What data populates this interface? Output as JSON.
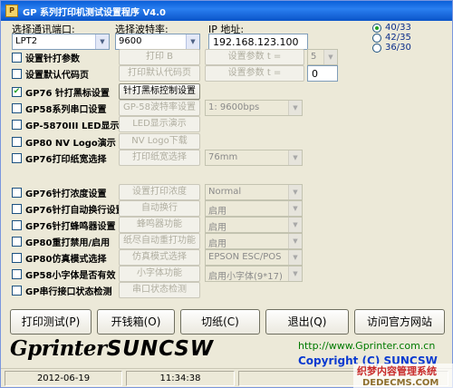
{
  "window": {
    "title": "GP 系列打印机测试设置程序 V4.0"
  },
  "port": {
    "label": "选择通讯端口:",
    "value": "LPT2"
  },
  "baud": {
    "label": "选择波特率:",
    "value": "9600"
  },
  "ip": {
    "label": "IP 地址:",
    "value": "192.168.123.100"
  },
  "radios": [
    {
      "label": "40/33",
      "selected": true
    },
    {
      "label": "42/35",
      "selected": false
    },
    {
      "label": "36/30",
      "selected": false
    }
  ],
  "checks": [
    {
      "label": "设置针打参数",
      "checked": false
    },
    {
      "label": "设置默认代码页",
      "checked": false
    },
    {
      "label": "GP76 针打黑标设置",
      "checked": true
    },
    {
      "label": "GP58系列串口设置",
      "checked": false
    },
    {
      "label": "GP-5870III LED显示",
      "checked": false
    },
    {
      "label": "GP80 NV Logo演示",
      "checked": false
    },
    {
      "label": "GP76打印纸宽选择",
      "checked": false
    },
    {
      "label": "GP76针打浓度设置",
      "checked": false
    },
    {
      "label": "GP76针打自动换行设置",
      "checked": false
    },
    {
      "label": "GP76针打蜂鸣器设置",
      "checked": false
    },
    {
      "label": "GP80重打禁用/启用",
      "checked": false
    },
    {
      "label": "GP80仿真模式选择",
      "checked": false
    },
    {
      "label": "GP58小字体是否有效",
      "checked": false
    },
    {
      "label": "GP串行接口状态检测",
      "checked": false
    }
  ],
  "buttons": [
    "打印 B",
    "打印默认代码页",
    "针打黑标控制设置",
    "GP-58波特率设置",
    "LED显示演示",
    "NV Logo下载",
    "打印纸宽选择",
    "设置打印浓度",
    "自动换行",
    "蜂鸣器功能",
    "纸尽自动重打功能",
    "仿真模式选择",
    "小字体功能",
    "串口状态检测"
  ],
  "param_buttons": [
    "设置参数  t =",
    "设置参数  t ="
  ],
  "param_values": [
    "5",
    "0"
  ],
  "combos": [
    "1: 9600bps",
    "76mm",
    "Normal",
    "启用",
    "启用",
    "启用",
    "EPSON ESC/POS",
    "启用小字体(9*17)"
  ],
  "bottom_buttons": [
    "打印测试(P)",
    "开钱箱(O)",
    "切纸(C)",
    "退出(Q)",
    "访问官方网站"
  ],
  "logo": {
    "text_left": "Gprinter",
    "text_right": "SUNCSW"
  },
  "website": "http://www.Gprinter.com.cn",
  "copyright": "Copyright (C) SUNCSW",
  "status": {
    "date": "2012-06-19",
    "time": "11:34:38"
  },
  "watermark": {
    "cn": "织梦内容管理系统",
    "en": "DEDECMS.COM"
  }
}
